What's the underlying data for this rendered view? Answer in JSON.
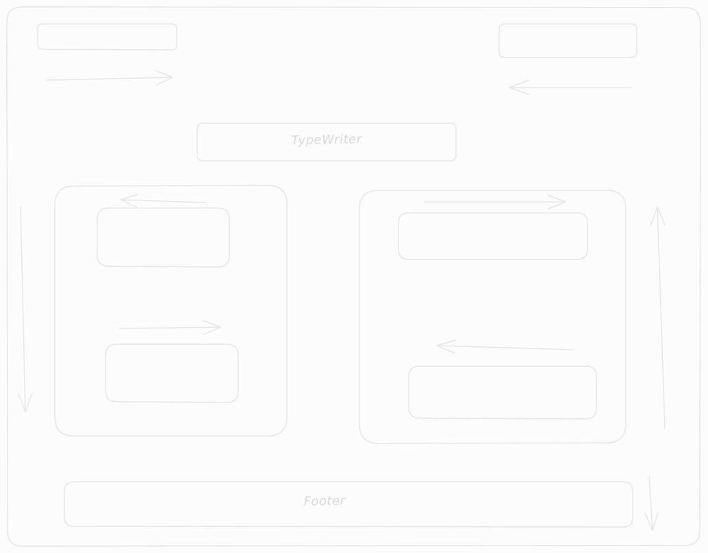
{
  "diagram": {
    "center_box_label": "TypeWriter",
    "footer_label": "Footer"
  },
  "colors": {
    "background": "#fcfcfc",
    "stroke": "#e6e6e6",
    "text": "#d9d9d9"
  }
}
